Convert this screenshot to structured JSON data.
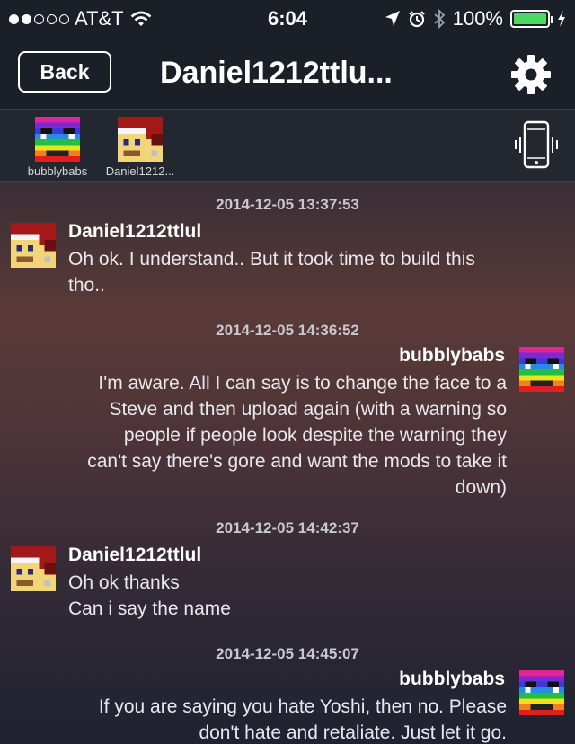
{
  "status_bar": {
    "carrier": "AT&T",
    "time": "6:04",
    "battery": "100%",
    "signal_strength": 2,
    "icons": [
      "signal-dots-icon",
      "wifi-icon",
      "location-icon",
      "alarm-icon",
      "bluetooth-icon",
      "battery-icon",
      "charging-icon"
    ]
  },
  "nav": {
    "back_label": "Back",
    "title": "Daniel1212ttlu...",
    "settings_icon": "gear-icon"
  },
  "participants": [
    {
      "label": "bubblybabs",
      "avatar": "rainbow-avatar"
    },
    {
      "label": "Daniel1212...",
      "avatar": "santa-hat-avatar"
    }
  ],
  "vibrate_icon": "phone-vibrate-icon",
  "messages": [
    {
      "timestamp": "2014-12-05 13:37:53",
      "sender": "Daniel1212ttlul",
      "side": "left",
      "lines": [
        "Oh ok. I understand.. But it took time to build this",
        "tho.."
      ]
    },
    {
      "timestamp": "2014-12-05 14:36:52",
      "sender": "bubblybabs",
      "side": "right",
      "lines": [
        "I'm aware.  All I can say is to change the face to a",
        "Steve and then upload again (with a warning so",
        "people if people look despite the warning they",
        "can't say there's gore and want the mods to take it",
        "down)"
      ]
    },
    {
      "timestamp": "2014-12-05 14:42:37",
      "sender": "Daniel1212ttlul",
      "side": "left",
      "lines": [
        "Oh ok thanks",
        "Can i say the name"
      ]
    },
    {
      "timestamp": "2014-12-05 14:45:07",
      "sender": "bubblybabs",
      "side": "right",
      "lines": [
        "If you are saying you hate Yoshi, then no.  Please",
        "don't hate and retaliate.  Just let it go."
      ]
    }
  ],
  "colors": {
    "bar_background": "#1b1f28",
    "battery_fill": "#4cd964",
    "accent_text": "#ffffff"
  }
}
